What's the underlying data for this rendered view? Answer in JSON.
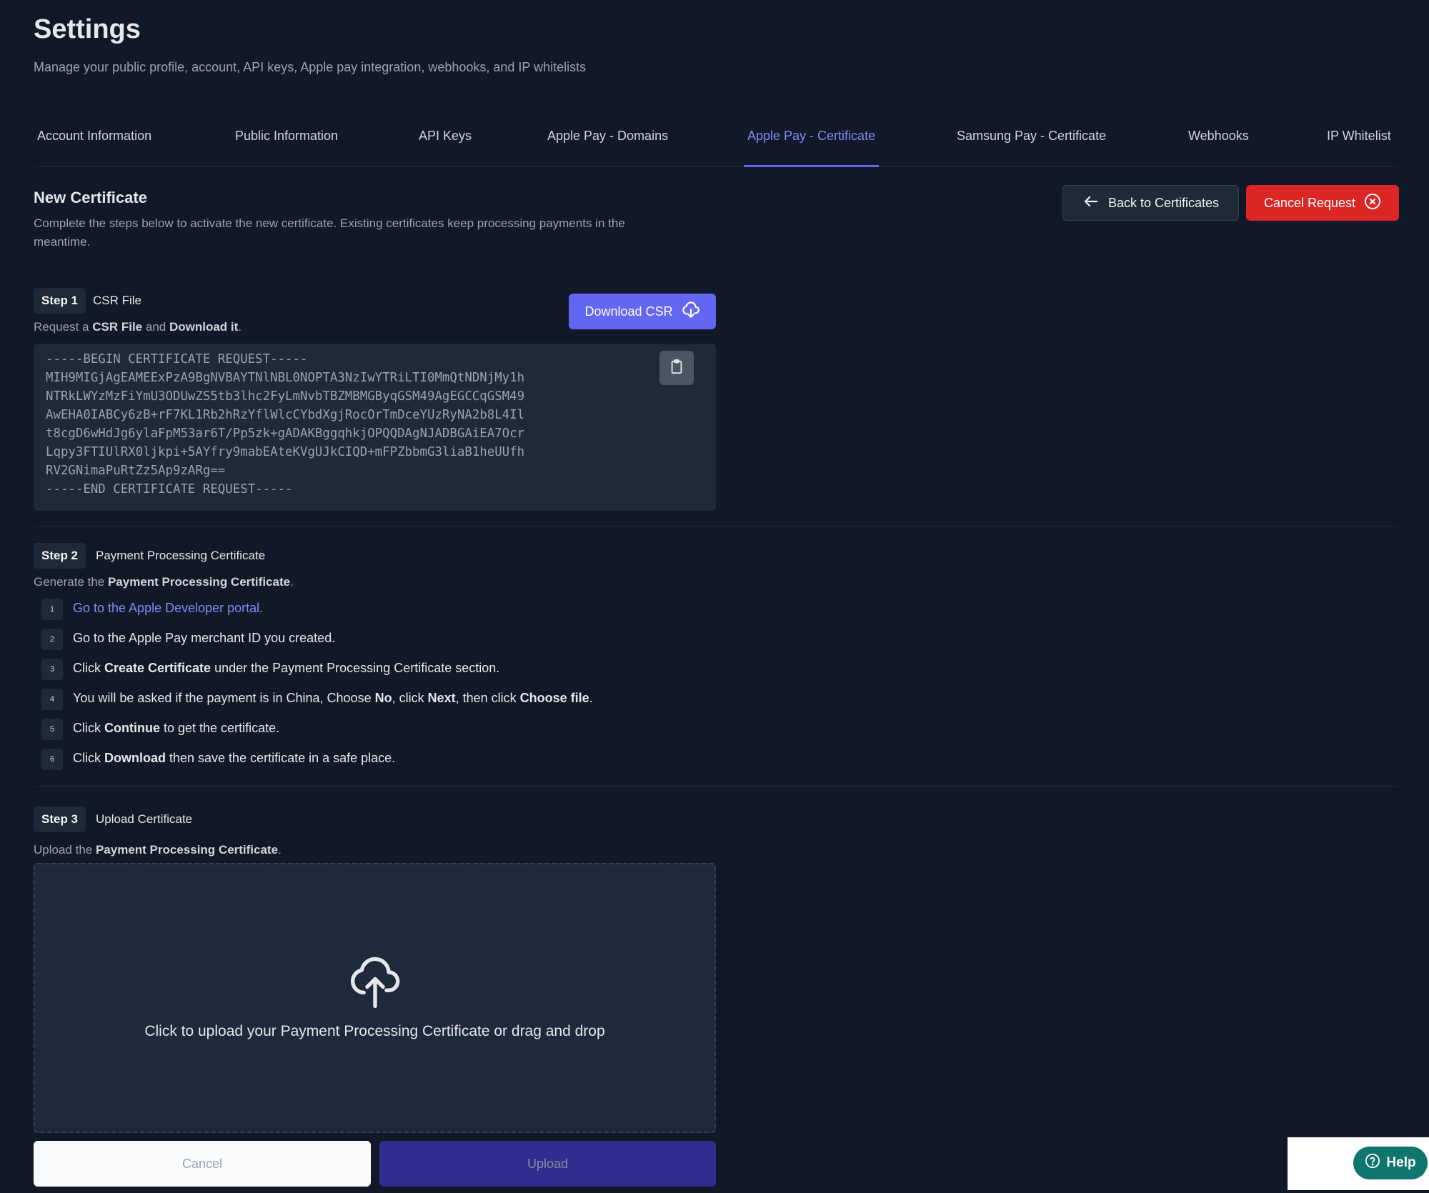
{
  "header": {
    "title": "Settings",
    "subtitle": "Manage your public profile, account, API keys, Apple pay integration, webhooks, and IP whitelists"
  },
  "tabs": [
    {
      "label": "Account Information"
    },
    {
      "label": "Public Information"
    },
    {
      "label": "API Keys"
    },
    {
      "label": "Apple Pay - Domains"
    },
    {
      "label": "Apple Pay - Certificate",
      "active": true
    },
    {
      "label": "Samsung Pay - Certificate"
    },
    {
      "label": "Webhooks"
    },
    {
      "label": "IP Whitelist"
    }
  ],
  "section": {
    "title": "New Certificate",
    "description": "Complete the steps below to activate the new certificate. Existing certificates keep processing payments in the meantime.",
    "back_label": "Back to Certificates",
    "cancel_request_label": "Cancel Request"
  },
  "step1": {
    "badge": "Step 1",
    "name": "CSR File",
    "desc_prefix": "Request a ",
    "desc_bold1": "CSR File",
    "desc_mid": " and ",
    "desc_bold2": "Download it",
    "desc_suffix": ".",
    "download_label": "Download CSR",
    "csr_lines": [
      "-----BEGIN CERTIFICATE REQUEST-----",
      "MIH9MIGjAgEAMEExPzA9BgNVBAYTNlNBL0NOPTA3NzIwYTRiLTI0MmQtNDNjMy1h",
      "NTRkLWYzMzFiYmU3ODUwZS5tb3lhc2FyLmNvbTBZMBMGByqGSM49AgEGCCqGSM49",
      "AwEHA0IABCy6zB+rF7KL1Rb2hRzYflWlcCYbdXgjRocOrTmDceYUzRyNA2b8L4Il",
      "t8cgD6wHdJg6ylaFpM53ar6T/Pp5zk+gADAKBggqhkjOPQQDAgNJADBGAiEA7Ocr",
      "Lqpy3FTIUlRX0ljkpi+5AYfry9mabEAteKVgUJkCIQD+mFPZbbmG3liaB1heUUfh",
      "RV2GNimaPuRtZz5Ap9zARg==",
      "-----END CERTIFICATE REQUEST-----"
    ]
  },
  "step2": {
    "badge": "Step 2",
    "name": "Payment Processing Certificate",
    "desc_prefix": "Generate the ",
    "desc_bold": "Payment Processing Certificate",
    "desc_suffix": ".",
    "items": [
      {
        "num": "1",
        "link": "Go to the Apple Developer portal."
      },
      {
        "num": "2",
        "text": "Go to the Apple Pay merchant ID you created."
      },
      {
        "num": "3",
        "p1": "Click ",
        "b1": "Create Certificate",
        "p2": " under the Payment Processing Certificate section."
      },
      {
        "num": "4",
        "p1": "You will be asked if the payment is in China, Choose ",
        "b1": "No",
        "p2": ", click ",
        "b2": "Next",
        "p3": ", then click ",
        "b3": "Choose file",
        "p4": "."
      },
      {
        "num": "5",
        "p1": "Click ",
        "b1": "Continue",
        "p2": " to get the certificate."
      },
      {
        "num": "6",
        "p1": "Click ",
        "b1": "Download",
        "p2": " then save the certificate in a safe place."
      }
    ]
  },
  "step3": {
    "badge": "Step 3",
    "name": "Upload Certificate",
    "desc_prefix": "Upload the ",
    "desc_bold": "Payment Processing Certificate",
    "desc_suffix": ".",
    "dropzone_text": "Click to upload your Payment Processing Certificate or drag and drop",
    "cancel_label": "Cancel",
    "upload_label": "Upload"
  },
  "help": {
    "label": "Help"
  },
  "colors": {
    "background": "#111827",
    "accent": "#6366f1",
    "danger": "#dc2626",
    "help": "#0f766e"
  }
}
